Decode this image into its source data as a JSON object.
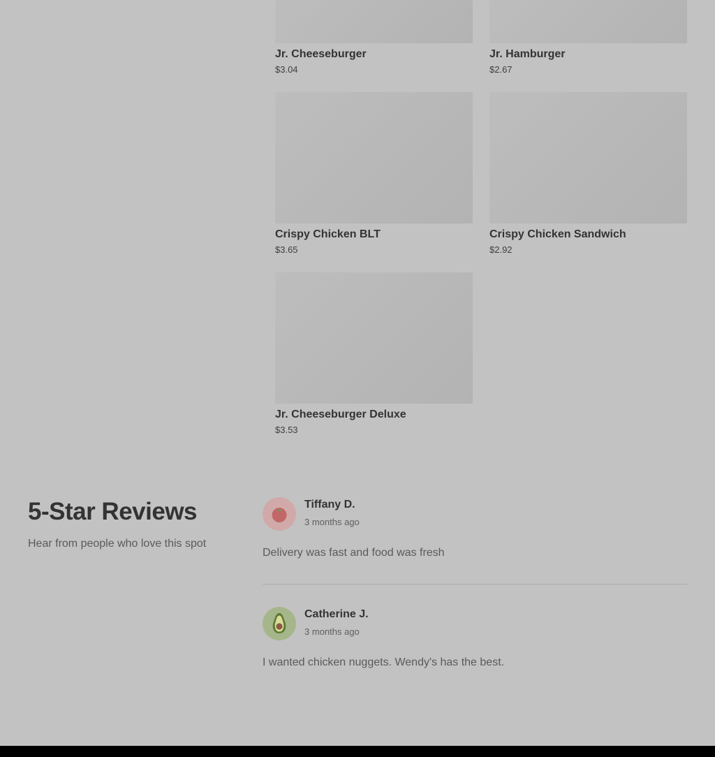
{
  "menu": {
    "items": [
      {
        "name": "Jr. Cheeseburger",
        "price": "$3.04"
      },
      {
        "name": "Jr. Hamburger",
        "price": "$2.67"
      },
      {
        "name": "Crispy Chicken BLT",
        "price": "$3.65"
      },
      {
        "name": "Crispy Chicken Sandwich",
        "price": "$2.92"
      },
      {
        "name": "Jr. Cheeseburger Deluxe",
        "price": "$3.53"
      }
    ]
  },
  "reviews": {
    "heading": "5-Star Reviews",
    "subheading": "Hear from people who love this spot",
    "items": [
      {
        "name": "Tiffany D.",
        "time": "3 months ago",
        "text": "Delivery was fast and food was fresh",
        "avatar_icon": "tomato-icon"
      },
      {
        "name": "Catherine J.",
        "time": "3 months ago",
        "text": "I wanted chicken nuggets. Wendy's has the best.",
        "avatar_icon": "avocado-icon"
      }
    ]
  }
}
